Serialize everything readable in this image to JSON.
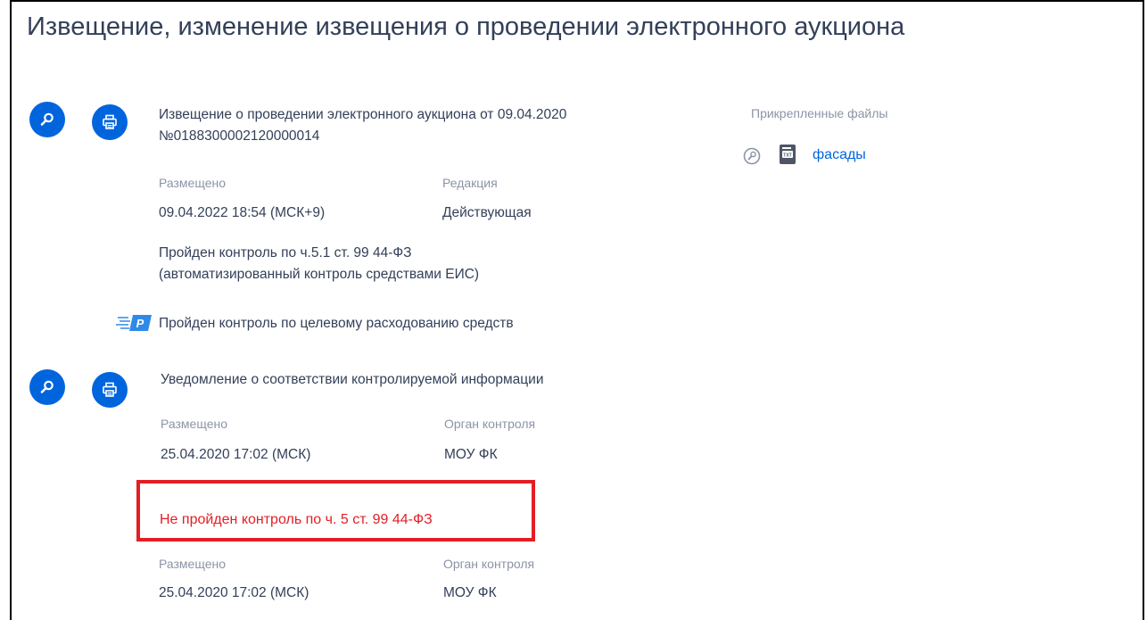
{
  "page_title": "Извещение, изменение извещения о проведении электронного аукциона",
  "notice": {
    "title_line1": "Извещение о проведении электронного аукциона от 09.04.2020",
    "title_line2": "№0188300002120000014",
    "placed_label": "Размещено",
    "placed_value": "09.04.2022 18:54 (МСК+9)",
    "revision_label": "Редакция",
    "revision_value": "Действующая",
    "control_line1": "Пройден контроль по ч.5.1 ст. 99 44-ФЗ",
    "control_line2": "(автоматизированный контроль средствами ЕИС)",
    "target_control": "Пройден контроль по целевому расходованию средств"
  },
  "attachments": {
    "label": "Прикрепленные файлы",
    "files": [
      {
        "name": "фасады"
      }
    ]
  },
  "notification": {
    "title": "Уведомление о соответствии контролируемой информации",
    "placed_label": "Размещено",
    "placed_value": "25.04.2020  17:02 (МСК)",
    "authority_label": "Орган контроля",
    "authority_value": "МОУ ФК"
  },
  "failed_control": {
    "text": "Не пройден контроль по ч. 5 ст. 99 44-ФЗ",
    "placed_label": "Размещено",
    "placed_value": "25.04.2020  17:02 (МСК)",
    "authority_label": "Орган контроля",
    "authority_value": "МОУ ФК"
  },
  "colors": {
    "accent": "#0065dd",
    "text": "#334059",
    "muted": "#8b94a6",
    "error": "#e31e24"
  }
}
